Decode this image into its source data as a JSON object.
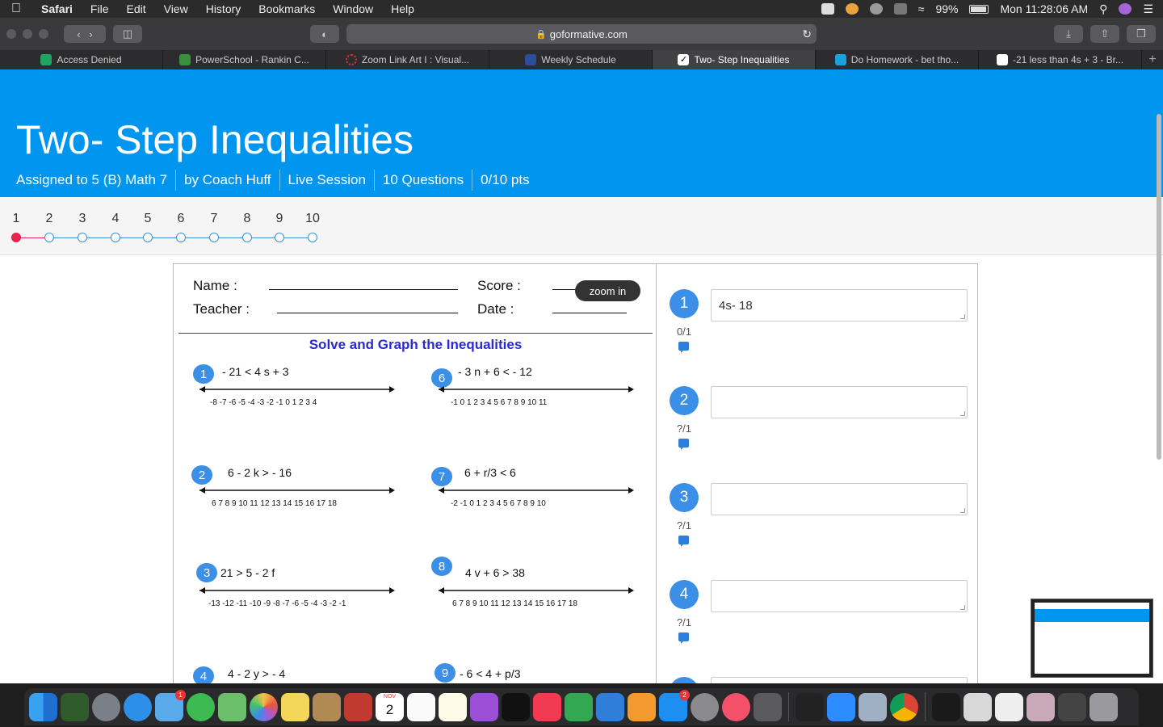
{
  "menubar": {
    "app": "Safari",
    "items": [
      "File",
      "Edit",
      "View",
      "History",
      "Bookmarks",
      "Window",
      "Help"
    ],
    "battery": "99%",
    "clock": "Mon 11:28:06 AM"
  },
  "browser": {
    "url": "goformative.com",
    "tabs": [
      {
        "label": "Access Denied",
        "color": "#1fa463"
      },
      {
        "label": "PowerSchool - Rankin C...",
        "color": "#3a8f3a"
      },
      {
        "label": "Zoom Link Art I : Visual...",
        "color": "#d33"
      },
      {
        "label": "Weekly Schedule",
        "color": "#2b4d9a"
      },
      {
        "label": "Two- Step Inequalities",
        "color": "#ffffff"
      },
      {
        "label": "Do Homework - bet tho...",
        "color": "#1aa1e0"
      },
      {
        "label": "-21 less than 4s + 3 - Br...",
        "color": "#ffffff"
      }
    ]
  },
  "assignment": {
    "title": "Two- Step Inequalities",
    "assigned": "Assigned to 5 (B) Math 7",
    "author": "by Coach Huff",
    "mode": "Live Session",
    "questions": "10 Questions",
    "points": "0/10 pts"
  },
  "question_nav": [
    "1",
    "2",
    "3",
    "4",
    "5",
    "6",
    "7",
    "8",
    "9",
    "10"
  ],
  "worksheet": {
    "name_label": "Name :",
    "score_label": "Score :",
    "teacher_label": "Teacher :",
    "date_label": "Date :",
    "zoom_label": "zoom in",
    "title": "Solve and Graph the Inequalities",
    "problems": [
      {
        "n": "1",
        "eq": "- 21  <  4 s + 3",
        "ticks": "-8 -7 -6 -5 -4 -3 -2 -1 0 1 2 3 4"
      },
      {
        "n": "6",
        "eq": "- 3 n + 6  < - 12",
        "ticks": "-1 0 1 2 3 4 5 6 7 8 9 10 11"
      },
      {
        "n": "2",
        "eq": "6 - 2 k  > - 16",
        "ticks": "6 7 8 9 10 11 12 13 14 15 16 17 18"
      },
      {
        "n": "7",
        "eq": "6 + r/3  < 6",
        "ticks": "-2 -1 0 1 2 3 4 5 6 7 8 9 10"
      },
      {
        "n": "3",
        "eq": "21  > 5 - 2 f",
        "ticks": "-13 -12 -11 -10 -9 -8 -7 -6 -5 -4 -3 -2 -1"
      },
      {
        "n": "8",
        "eq": "4 v + 6  > 38",
        "ticks": "6 7 8 9 10 11 12 13 14 15 16 17 18"
      },
      {
        "n": "4",
        "eq": "4 - 2 y  > - 4",
        "ticks": ""
      },
      {
        "n": "9",
        "eq": "- 6  <  4 + p/3",
        "ticks": ""
      }
    ]
  },
  "answers": [
    {
      "n": "1",
      "value": "4s- 18",
      "pts": "0/1"
    },
    {
      "n": "2",
      "value": "",
      "pts": "?/1"
    },
    {
      "n": "3",
      "value": "",
      "pts": "?/1"
    },
    {
      "n": "4",
      "value": "",
      "pts": "?/1"
    }
  ],
  "dock": {
    "icons": [
      "finder-icon",
      "school-app-icon",
      "launchpad-icon",
      "safari-icon",
      "mail-icon",
      "messages-icon",
      "maps-icon",
      "photos-icon",
      "stickies-icon",
      "contacts-icon",
      "photo-booth-icon",
      "calendar-icon",
      "reminders-icon",
      "notes-icon",
      "podcasts-icon",
      "apple-tv-icon",
      "news-icon",
      "numbers-icon",
      "keynote-icon",
      "pages-icon",
      "app-store-icon",
      "system-preferences-icon",
      "music-icon",
      "imovie-icon",
      "piano-icon",
      "zoom-icon",
      "preview-icon",
      "chrome-icon",
      "terminal-icon",
      "screenshot-icon",
      "document-icon",
      "photo-collage-icon",
      "finder-window-icon",
      "trash-icon"
    ],
    "badges": {
      "mail-icon": "1",
      "app-store-icon": "2"
    },
    "calendar": {
      "month": "NOV",
      "day": "2"
    }
  }
}
